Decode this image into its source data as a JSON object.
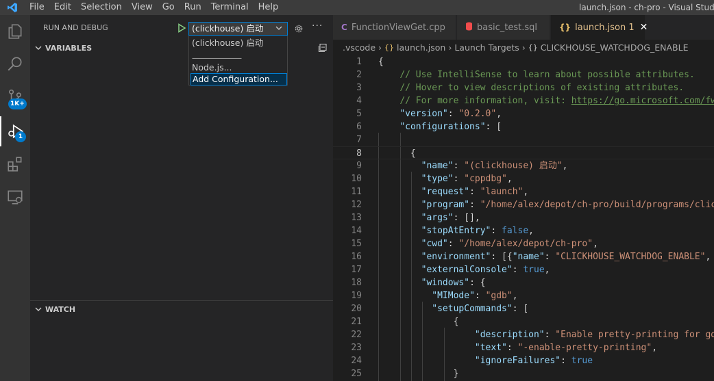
{
  "window_title": "launch.json - ch-pro - Visual Studio C",
  "menu": [
    "File",
    "Edit",
    "Selection",
    "View",
    "Go",
    "Run",
    "Terminal",
    "Help"
  ],
  "activity_badges": {
    "source_control": "1K+",
    "debug": "1"
  },
  "sidebar": {
    "title": "RUN AND DEBUG",
    "selected_config": "(clickhouse) 启动",
    "dropdown": {
      "items": [
        "(clickhouse) 启动",
        "Node.js...",
        "Add Configuration..."
      ],
      "separator": "————————"
    },
    "sections": {
      "variables": "VARIABLES",
      "watch": "WATCH"
    }
  },
  "tabs": [
    {
      "label": "FunctionViewGet.cpp",
      "icon": "C"
    },
    {
      "label": "basic_test.sql",
      "icon": "db"
    },
    {
      "label": "launch.json 1",
      "icon": "{}"
    }
  ],
  "breadcrumb": [
    ".vscode",
    "launch.json",
    "Launch Targets",
    "CLICKHOUSE_WATCHDOG_ENABLE"
  ],
  "colors": {
    "accent": "#007acc",
    "json_icon": "#e8c06b",
    "sql_icon": "#f14c4c",
    "cpp_icon": "#a074c4"
  },
  "code_lines": [
    {
      "n": "1",
      "t": [
        [
          "p",
          "{"
        ]
      ]
    },
    {
      "n": "2",
      "t": [
        [
          "p",
          "    "
        ],
        [
          "c",
          "// Use IntelliSense to learn about possible attributes."
        ]
      ]
    },
    {
      "n": "3",
      "t": [
        [
          "p",
          "    "
        ],
        [
          "c",
          "// Hover to view descriptions of existing attributes."
        ]
      ]
    },
    {
      "n": "4",
      "t": [
        [
          "p",
          "    "
        ],
        [
          "c",
          "// For more information, visit: "
        ],
        [
          "l",
          "https://go.microsoft.com/fwl"
        ]
      ]
    },
    {
      "n": "5",
      "t": [
        [
          "p",
          "    "
        ],
        [
          "k",
          "\"version\""
        ],
        [
          "p",
          ": "
        ],
        [
          "s",
          "\"0.2.0\""
        ],
        [
          "p",
          ","
        ]
      ]
    },
    {
      "n": "6",
      "t": [
        [
          "p",
          "    "
        ],
        [
          "k",
          "\"configurations\""
        ],
        [
          "p",
          ": ["
        ]
      ]
    },
    {
      "n": "7",
      "t": [
        [
          "p",
          ""
        ]
      ]
    },
    {
      "n": "8",
      "t": [
        [
          "p",
          "      {"
        ]
      ]
    },
    {
      "n": "9",
      "t": [
        [
          "p",
          "        "
        ],
        [
          "k",
          "\"name\""
        ],
        [
          "p",
          ": "
        ],
        [
          "s",
          "\"(clickhouse) 启动\""
        ],
        [
          "p",
          ","
        ]
      ]
    },
    {
      "n": "10",
      "t": [
        [
          "p",
          "        "
        ],
        [
          "k",
          "\"type\""
        ],
        [
          "p",
          ": "
        ],
        [
          "s",
          "\"cppdbg\""
        ],
        [
          "p",
          ","
        ]
      ]
    },
    {
      "n": "11",
      "t": [
        [
          "p",
          "        "
        ],
        [
          "k",
          "\"request\""
        ],
        [
          "p",
          ": "
        ],
        [
          "s",
          "\"launch\""
        ],
        [
          "p",
          ","
        ]
      ]
    },
    {
      "n": "12",
      "t": [
        [
          "p",
          "        "
        ],
        [
          "k",
          "\"program\""
        ],
        [
          "p",
          ": "
        ],
        [
          "s",
          "\"/home/alex/depot/ch-pro/build/programs/click"
        ]
      ]
    },
    {
      "n": "13",
      "t": [
        [
          "p",
          "        "
        ],
        [
          "k",
          "\"args\""
        ],
        [
          "p",
          ": [],"
        ]
      ]
    },
    {
      "n": "14",
      "t": [
        [
          "p",
          "        "
        ],
        [
          "k",
          "\"stopAtEntry\""
        ],
        [
          "p",
          ": "
        ],
        [
          "b",
          "false"
        ],
        [
          "p",
          ","
        ]
      ]
    },
    {
      "n": "15",
      "t": [
        [
          "p",
          "        "
        ],
        [
          "k",
          "\"cwd\""
        ],
        [
          "p",
          ": "
        ],
        [
          "s",
          "\"/home/alex/depot/ch-pro\""
        ],
        [
          "p",
          ","
        ]
      ]
    },
    {
      "n": "16",
      "t": [
        [
          "p",
          "        "
        ],
        [
          "k",
          "\"environment\""
        ],
        [
          "p",
          ": [{"
        ],
        [
          "k",
          "\"name\""
        ],
        [
          "p",
          ": "
        ],
        [
          "s",
          "\"CLICKHOUSE_WATCHDOG_ENABLE\""
        ],
        [
          "p",
          ", \""
        ]
      ]
    },
    {
      "n": "17",
      "t": [
        [
          "p",
          "        "
        ],
        [
          "k",
          "\"externalConsole\""
        ],
        [
          "p",
          ": "
        ],
        [
          "b",
          "true"
        ],
        [
          "p",
          ","
        ]
      ]
    },
    {
      "n": "18",
      "t": [
        [
          "p",
          "        "
        ],
        [
          "k",
          "\"windows\""
        ],
        [
          "p",
          ": {"
        ]
      ]
    },
    {
      "n": "19",
      "t": [
        [
          "p",
          "          "
        ],
        [
          "k",
          "\"MIMode\""
        ],
        [
          "p",
          ": "
        ],
        [
          "s",
          "\"gdb\""
        ],
        [
          "p",
          ","
        ]
      ]
    },
    {
      "n": "20",
      "t": [
        [
          "p",
          "          "
        ],
        [
          "k",
          "\"setupCommands\""
        ],
        [
          "p",
          ": ["
        ]
      ]
    },
    {
      "n": "21",
      "t": [
        [
          "p",
          "              {"
        ]
      ]
    },
    {
      "n": "22",
      "t": [
        [
          "p",
          "                  "
        ],
        [
          "k",
          "\"description\""
        ],
        [
          "p",
          ": "
        ],
        [
          "s",
          "\"Enable pretty-printing for gdb"
        ]
      ]
    },
    {
      "n": "23",
      "t": [
        [
          "p",
          "                  "
        ],
        [
          "k",
          "\"text\""
        ],
        [
          "p",
          ": "
        ],
        [
          "s",
          "\"-enable-pretty-printing\""
        ],
        [
          "p",
          ","
        ]
      ]
    },
    {
      "n": "24",
      "t": [
        [
          "p",
          "                  "
        ],
        [
          "k",
          "\"ignoreFailures\""
        ],
        [
          "p",
          ": "
        ],
        [
          "b",
          "true"
        ]
      ]
    },
    {
      "n": "25",
      "t": [
        [
          "p",
          "              }"
        ]
      ]
    }
  ]
}
